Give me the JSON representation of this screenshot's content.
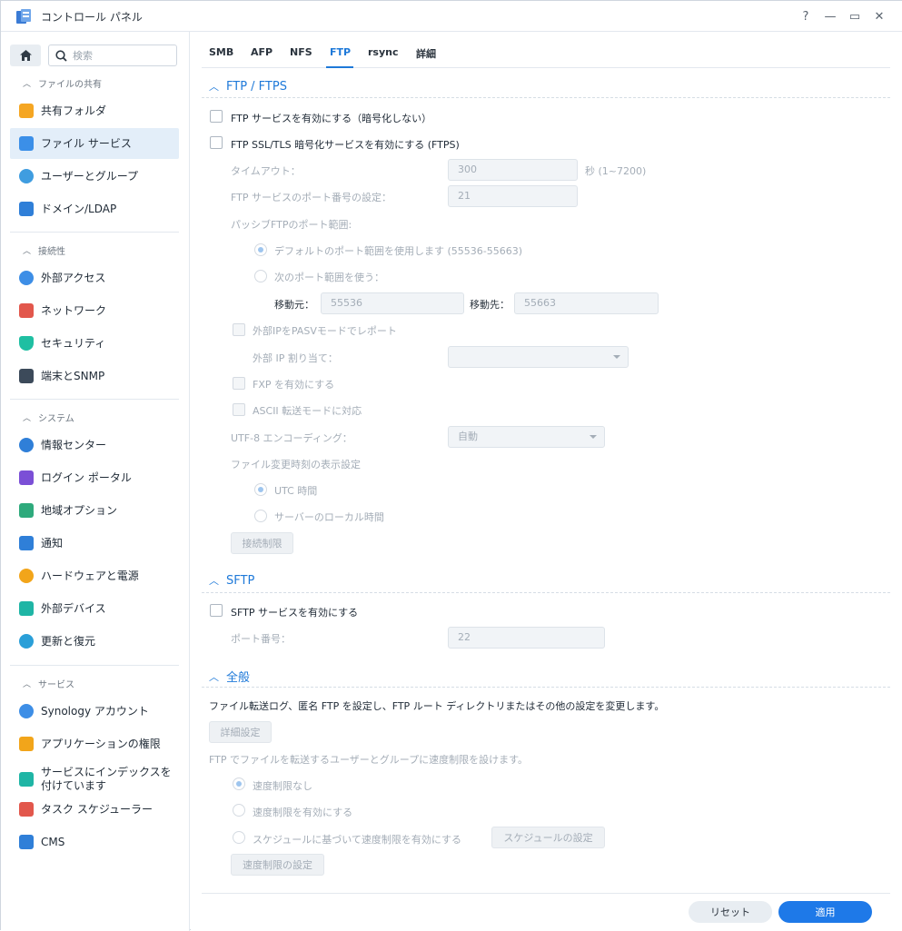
{
  "window": {
    "title": "コントロール パネル"
  },
  "titlebar": {
    "help": "?",
    "minimize": "—",
    "maximize": "▭",
    "close": "✕"
  },
  "sidebar": {
    "search_placeholder": "検索",
    "sections": [
      {
        "header": "ファイルの共有",
        "items": [
          "共有フォルダ",
          "ファイル サービス",
          "ユーザーとグループ",
          "ドメイン/LDAP"
        ]
      },
      {
        "header": "接続性",
        "items": [
          "外部アクセス",
          "ネットワーク",
          "セキュリティ",
          "端末とSNMP"
        ]
      },
      {
        "header": "システム",
        "items": [
          "情報センター",
          "ログイン ポータル",
          "地域オプション",
          "通知",
          "ハードウェアと電源",
          "外部デバイス",
          "更新と復元"
        ]
      },
      {
        "header": "サービス",
        "items": [
          "Synology アカウント",
          "アプリケーションの権限",
          "サービスにインデックスを付けています",
          "タスク スケジューラー",
          "CMS"
        ]
      }
    ],
    "active_item": "ファイル サービス"
  },
  "tabs": [
    "SMB",
    "AFP",
    "NFS",
    "FTP",
    "rsync",
    "詳細"
  ],
  "active_tab": "FTP",
  "ftp": {
    "title": "FTP / FTPS",
    "enable_ftp": "FTP サービスを有効にする（暗号化しない）",
    "enable_ftps": "FTP SSL/TLS 暗号化サービスを有効にする (FTPS)",
    "timeout_label": "タイムアウト：",
    "timeout_value": "300",
    "timeout_unit": "秒 (1~7200)",
    "port_label": "FTP サービスのポート番号の設定：",
    "port_value": "21",
    "passive_label": "パッシブFTPのポート範囲:",
    "passive_default": "デフォルトのポート範囲を使用します (55536-55663)",
    "passive_custom": "次のポート範囲を使う：",
    "from_label": "移動元：",
    "from_value": "55536",
    "to_label": "移動先：",
    "to_value": "55663",
    "report_ip": "外部IPをPASVモードでレポート",
    "ext_ip_label": "外部 IP 割り当て：",
    "ext_ip_value": "",
    "fxp": "FXP を有効にする",
    "ascii": "ASCII 転送モードに対応",
    "utf8_label": "UTF-8 エンコーディング：",
    "utf8_value": "自動",
    "time_label": "ファイル変更時刻の表示設定",
    "utc": "UTC 時間",
    "local_time": "サーバーのローカル時間",
    "conn_limit_btn": "接続制限"
  },
  "sftp": {
    "title": "SFTP",
    "enable": "SFTP サービスを有効にする",
    "port_label": "ポート番号：",
    "port_value": "22"
  },
  "general": {
    "title": "全般",
    "desc": "ファイル転送ログ、匿名 FTP を設定し、FTP ルート ディレクトリまたはその他の設定を変更します。",
    "advanced_btn": "詳細設定",
    "speed_desc": "FTP でファイルを転送するユーザーとグループに速度制限を設けます。",
    "no_limit": "速度制限なし",
    "enable_limit": "速度制限を有効にする",
    "schedule_limit": "スケジュールに基づいて速度制限を有効にする",
    "schedule_btn": "スケジュールの設定",
    "speed_btn": "速度制限の設定"
  },
  "footer": {
    "reset": "リセット",
    "apply": "適用"
  }
}
